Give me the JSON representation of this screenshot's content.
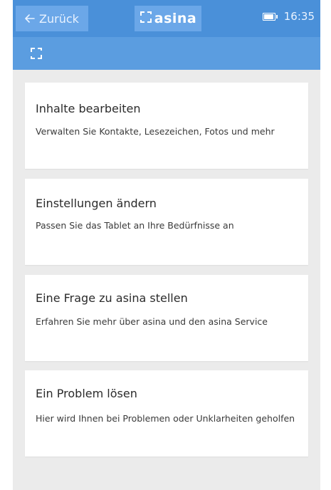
{
  "header": {
    "back_label": "Zurück",
    "back_icon": "arrow-left-icon",
    "brand_name": "asina",
    "brand_icon": "asina-logo-icon",
    "battery_icon": "battery-icon",
    "time": "16:35"
  },
  "subheader": {
    "icon": "asina-logo-icon"
  },
  "colors": {
    "header_bg": "#4a90d9",
    "subheader_bg": "#5b9de0",
    "button_bg": "#6ba7e8",
    "page_bg": "#ebebeb",
    "card_bg": "#ffffff"
  },
  "cards": [
    {
      "title": "Inhalte bearbeiten",
      "description": "Verwalten Sie Kontakte, Lesezeichen, Fotos und mehr"
    },
    {
      "title": "Einstellungen ändern",
      "description": "Passen Sie das Tablet an Ihre Bedürfnisse an"
    },
    {
      "title": "Eine Frage zu asina stellen",
      "description": "Erfahren Sie mehr über asina und den asina Service"
    },
    {
      "title": "Ein Problem lösen",
      "description": "Hier wird Ihnen bei Problemen oder Unklarheiten geholfen"
    }
  ]
}
